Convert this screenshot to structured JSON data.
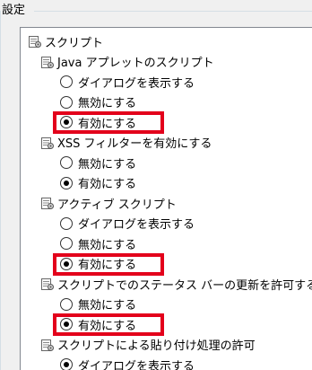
{
  "group": {
    "title": "設定"
  },
  "tree": {
    "root": {
      "label": "スクリプト",
      "icon": "settings-node-icon"
    },
    "sections": [
      {
        "label": "Java アプレットのスクリプト",
        "icon": "settings-node-icon",
        "options": [
          {
            "label": "ダイアログを表示する",
            "selected": false
          },
          {
            "label": "無効にする",
            "selected": false
          },
          {
            "label": "有効にする",
            "selected": true,
            "highlighted": true
          }
        ]
      },
      {
        "label": "XSS フィルターを有効にする",
        "icon": "settings-node-icon",
        "options": [
          {
            "label": "無効にする",
            "selected": false
          },
          {
            "label": "有効にする",
            "selected": true,
            "highlighted": false
          }
        ]
      },
      {
        "label": "アクティブ スクリプト",
        "icon": "settings-node-icon",
        "options": [
          {
            "label": "ダイアログを表示する",
            "selected": false
          },
          {
            "label": "無効にする",
            "selected": false
          },
          {
            "label": "有効にする",
            "selected": true,
            "highlighted": true
          }
        ]
      },
      {
        "label": "スクリプトでのステータス バーの更新を許可する",
        "icon": "settings-node-icon",
        "options": [
          {
            "label": "無効にする",
            "selected": false
          },
          {
            "label": "有効にする",
            "selected": true,
            "highlighted": true
          }
        ]
      },
      {
        "label": "スクリプトによる貼り付け処理の許可",
        "icon": "settings-node-icon",
        "options": [
          {
            "label": "ダイアログを表示する",
            "selected": true,
            "highlighted": false
          }
        ]
      }
    ]
  },
  "colors": {
    "highlight": "#e3001b",
    "tree_border": "#828790"
  }
}
